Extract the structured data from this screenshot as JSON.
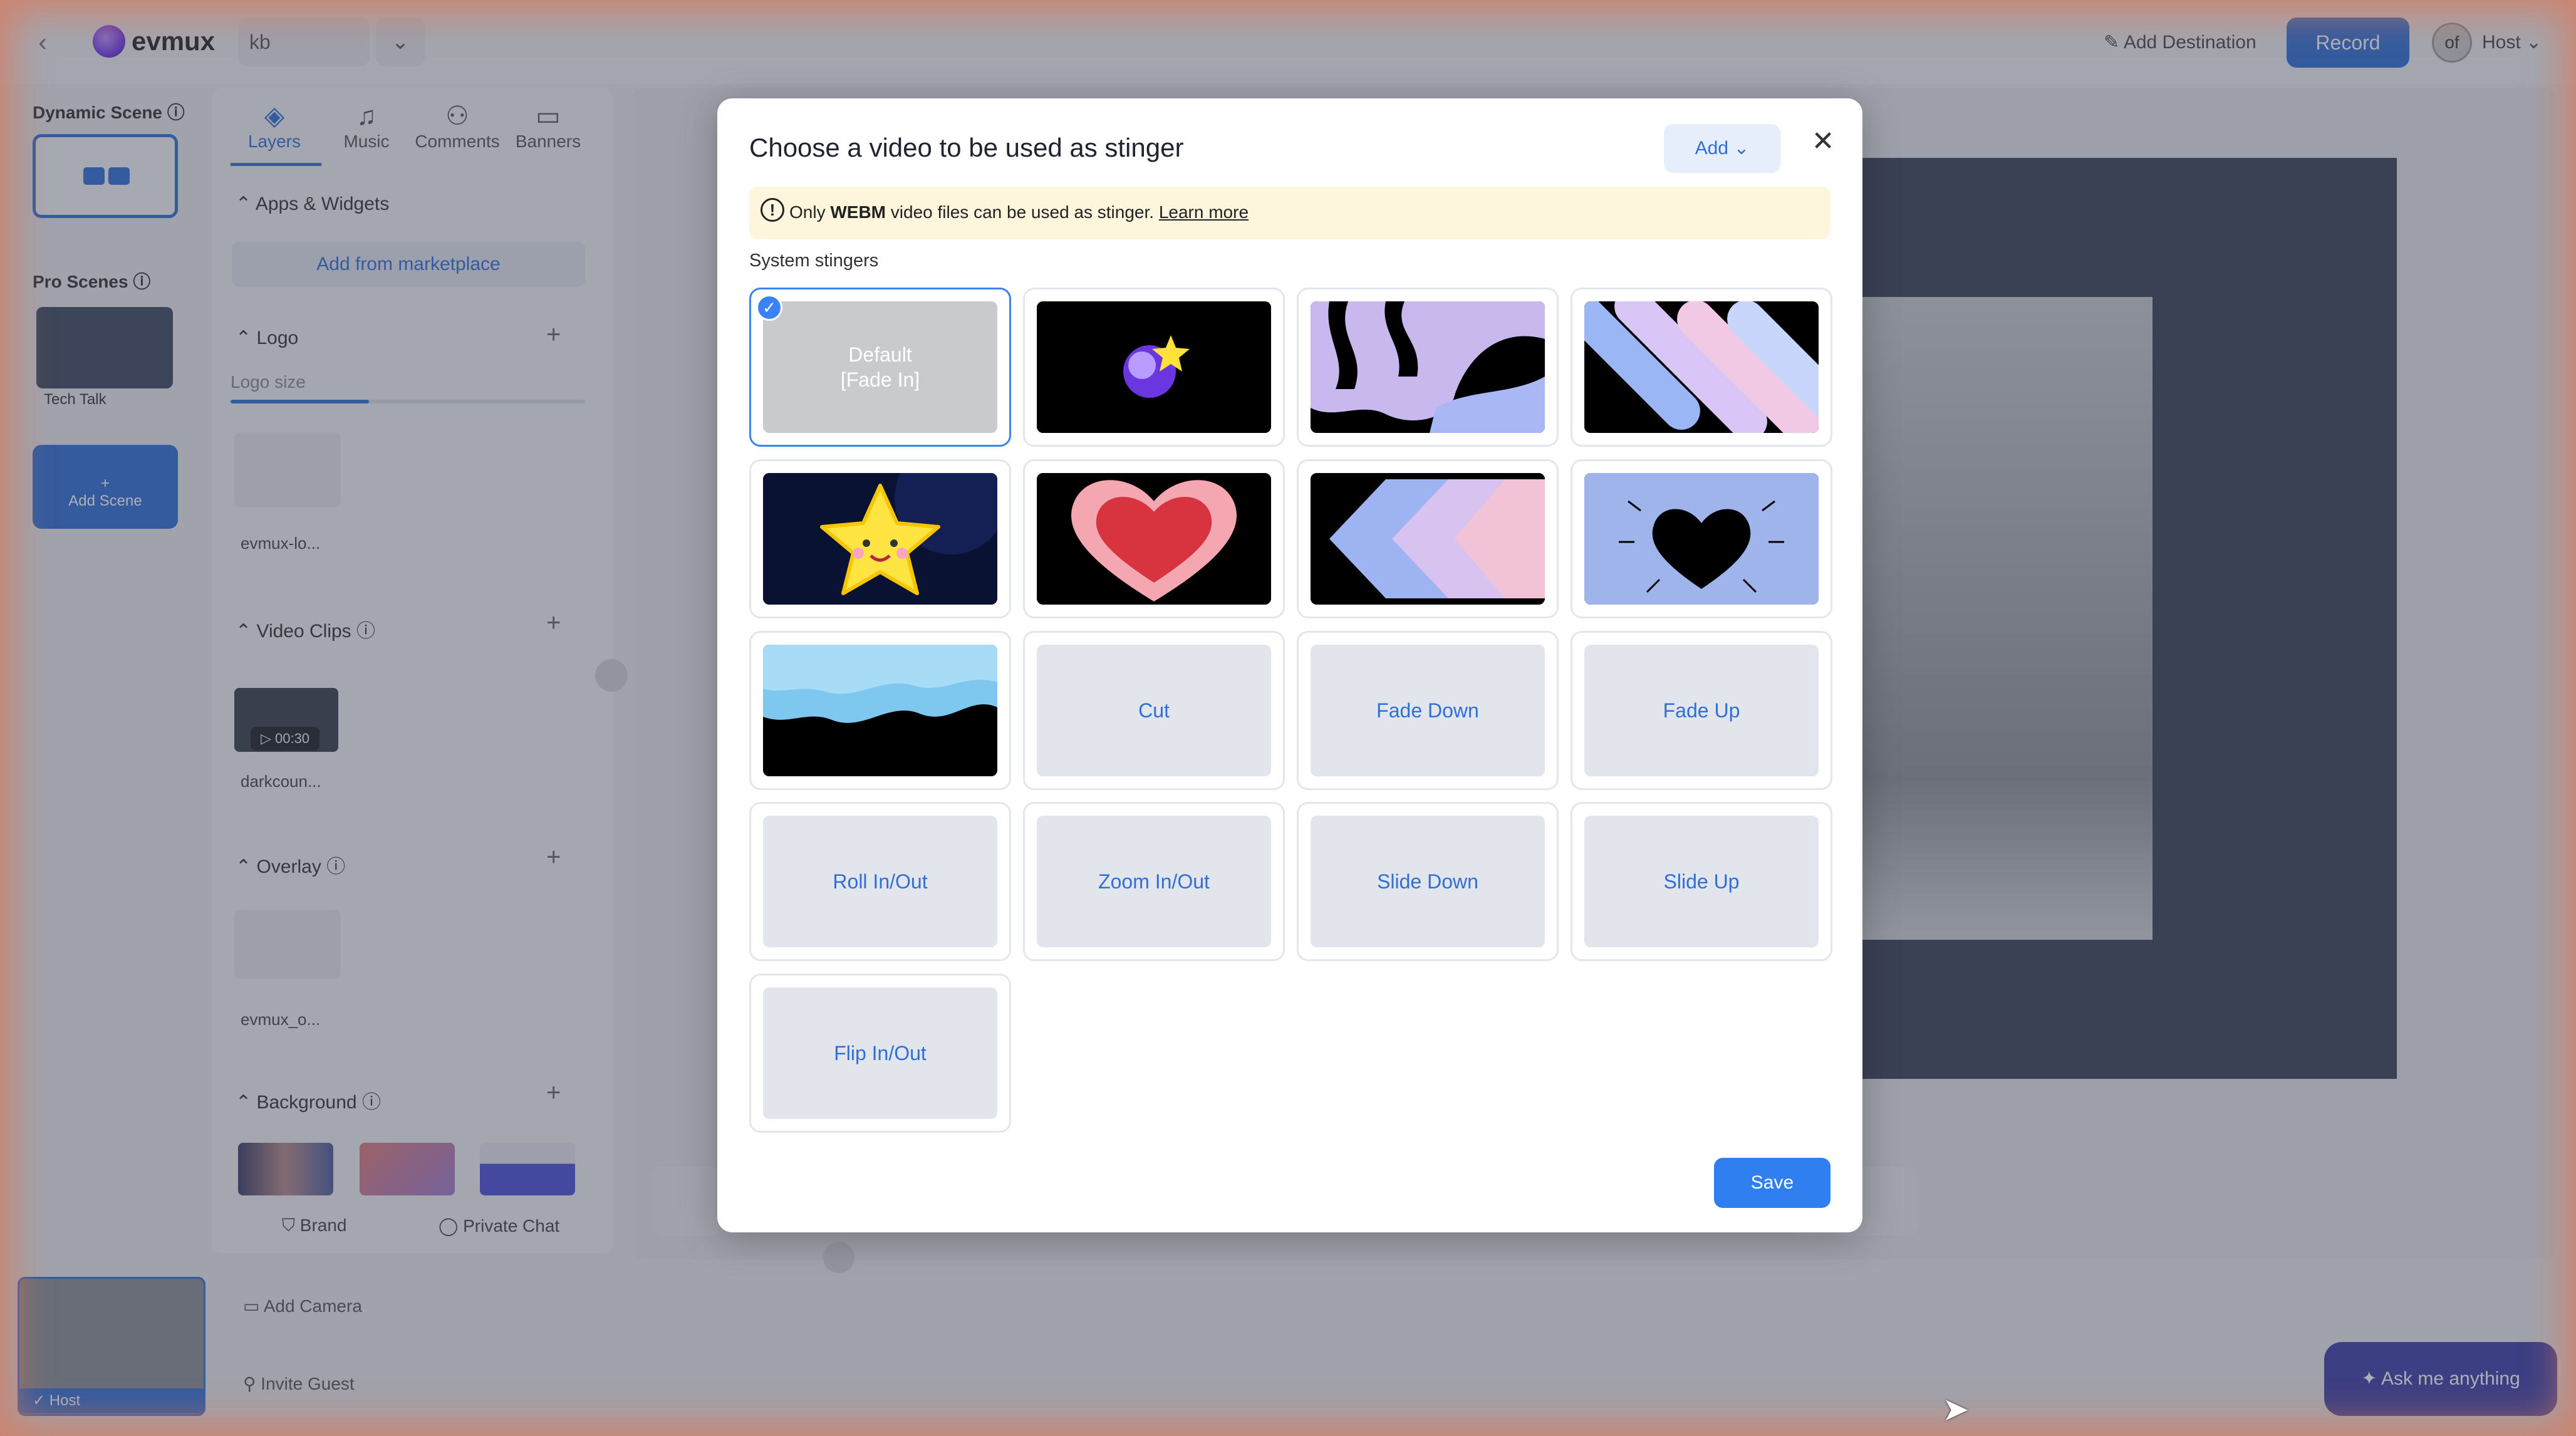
{
  "app": {
    "brand": "evmux",
    "project": "kb",
    "chevron": "⌄"
  },
  "topbar": {
    "add_destination": "Add Destination",
    "record": "Record",
    "avatar_initials": "of",
    "host": "Host ⌄"
  },
  "scenes": {
    "dynamic_title": "Dynamic Scene",
    "pro_title": "Pro Scenes",
    "tech_talk": "Tech Talk",
    "add_scene": "Add Scene"
  },
  "panel": {
    "tabs": [
      "Layers",
      "Music",
      "Comments",
      "Banners"
    ],
    "apps_title": "Apps & Widgets",
    "marketplace": "Add from marketplace",
    "logo_title": "Logo",
    "logo_size": "Logo size",
    "logo_size_fraction": 0.39,
    "logo_item": "evmux-lo...",
    "video_title": "Video Clips",
    "clip_duration": "▷ 00:30",
    "clip_item": "darkcoun...",
    "overlay_title": "Overlay",
    "overlay_item": "evmux_o...",
    "background_title": "Background",
    "brand": "Brand",
    "private_chat": "Private Chat"
  },
  "bottom": {
    "host_tile": "Host",
    "add_camera": "Add Camera",
    "invite_guest": "Invite Guest",
    "ask": "Ask me anything"
  },
  "modal": {
    "title": "Choose a video to be used as stinger",
    "add": "Add ⌄",
    "close": "✕",
    "notice_prefix": "Only ",
    "notice_bold": "WEBM",
    "notice_suffix": " video files can be used as stinger. ",
    "notice_link": "Learn more",
    "section": "System stingers",
    "save": "Save",
    "stingers": [
      {
        "label": "Default\n[Fade In]",
        "kind": "default",
        "selected": true
      },
      {
        "label": "",
        "kind": "image",
        "icon": "comet-icon"
      },
      {
        "label": "",
        "kind": "image",
        "icon": "paint-swirl-icon"
      },
      {
        "label": "",
        "kind": "image",
        "icon": "diagonal-bars-icon"
      },
      {
        "label": "",
        "kind": "image",
        "icon": "star-icon"
      },
      {
        "label": "",
        "kind": "image",
        "icon": "heart-icon"
      },
      {
        "label": "",
        "kind": "image",
        "icon": "chevrons-icon"
      },
      {
        "label": "",
        "kind": "image",
        "icon": "heart-burst-icon"
      },
      {
        "label": "",
        "kind": "image",
        "icon": "wave-icon"
      },
      {
        "label": "Cut",
        "kind": "text"
      },
      {
        "label": "Fade Down",
        "kind": "text"
      },
      {
        "label": "Fade Up",
        "kind": "text"
      },
      {
        "label": "Roll In/Out",
        "kind": "text"
      },
      {
        "label": "Zoom In/Out",
        "kind": "text"
      },
      {
        "label": "Slide Down",
        "kind": "text"
      },
      {
        "label": "Slide Up",
        "kind": "text"
      },
      {
        "label": "Flip In/Out",
        "kind": "text"
      }
    ]
  }
}
